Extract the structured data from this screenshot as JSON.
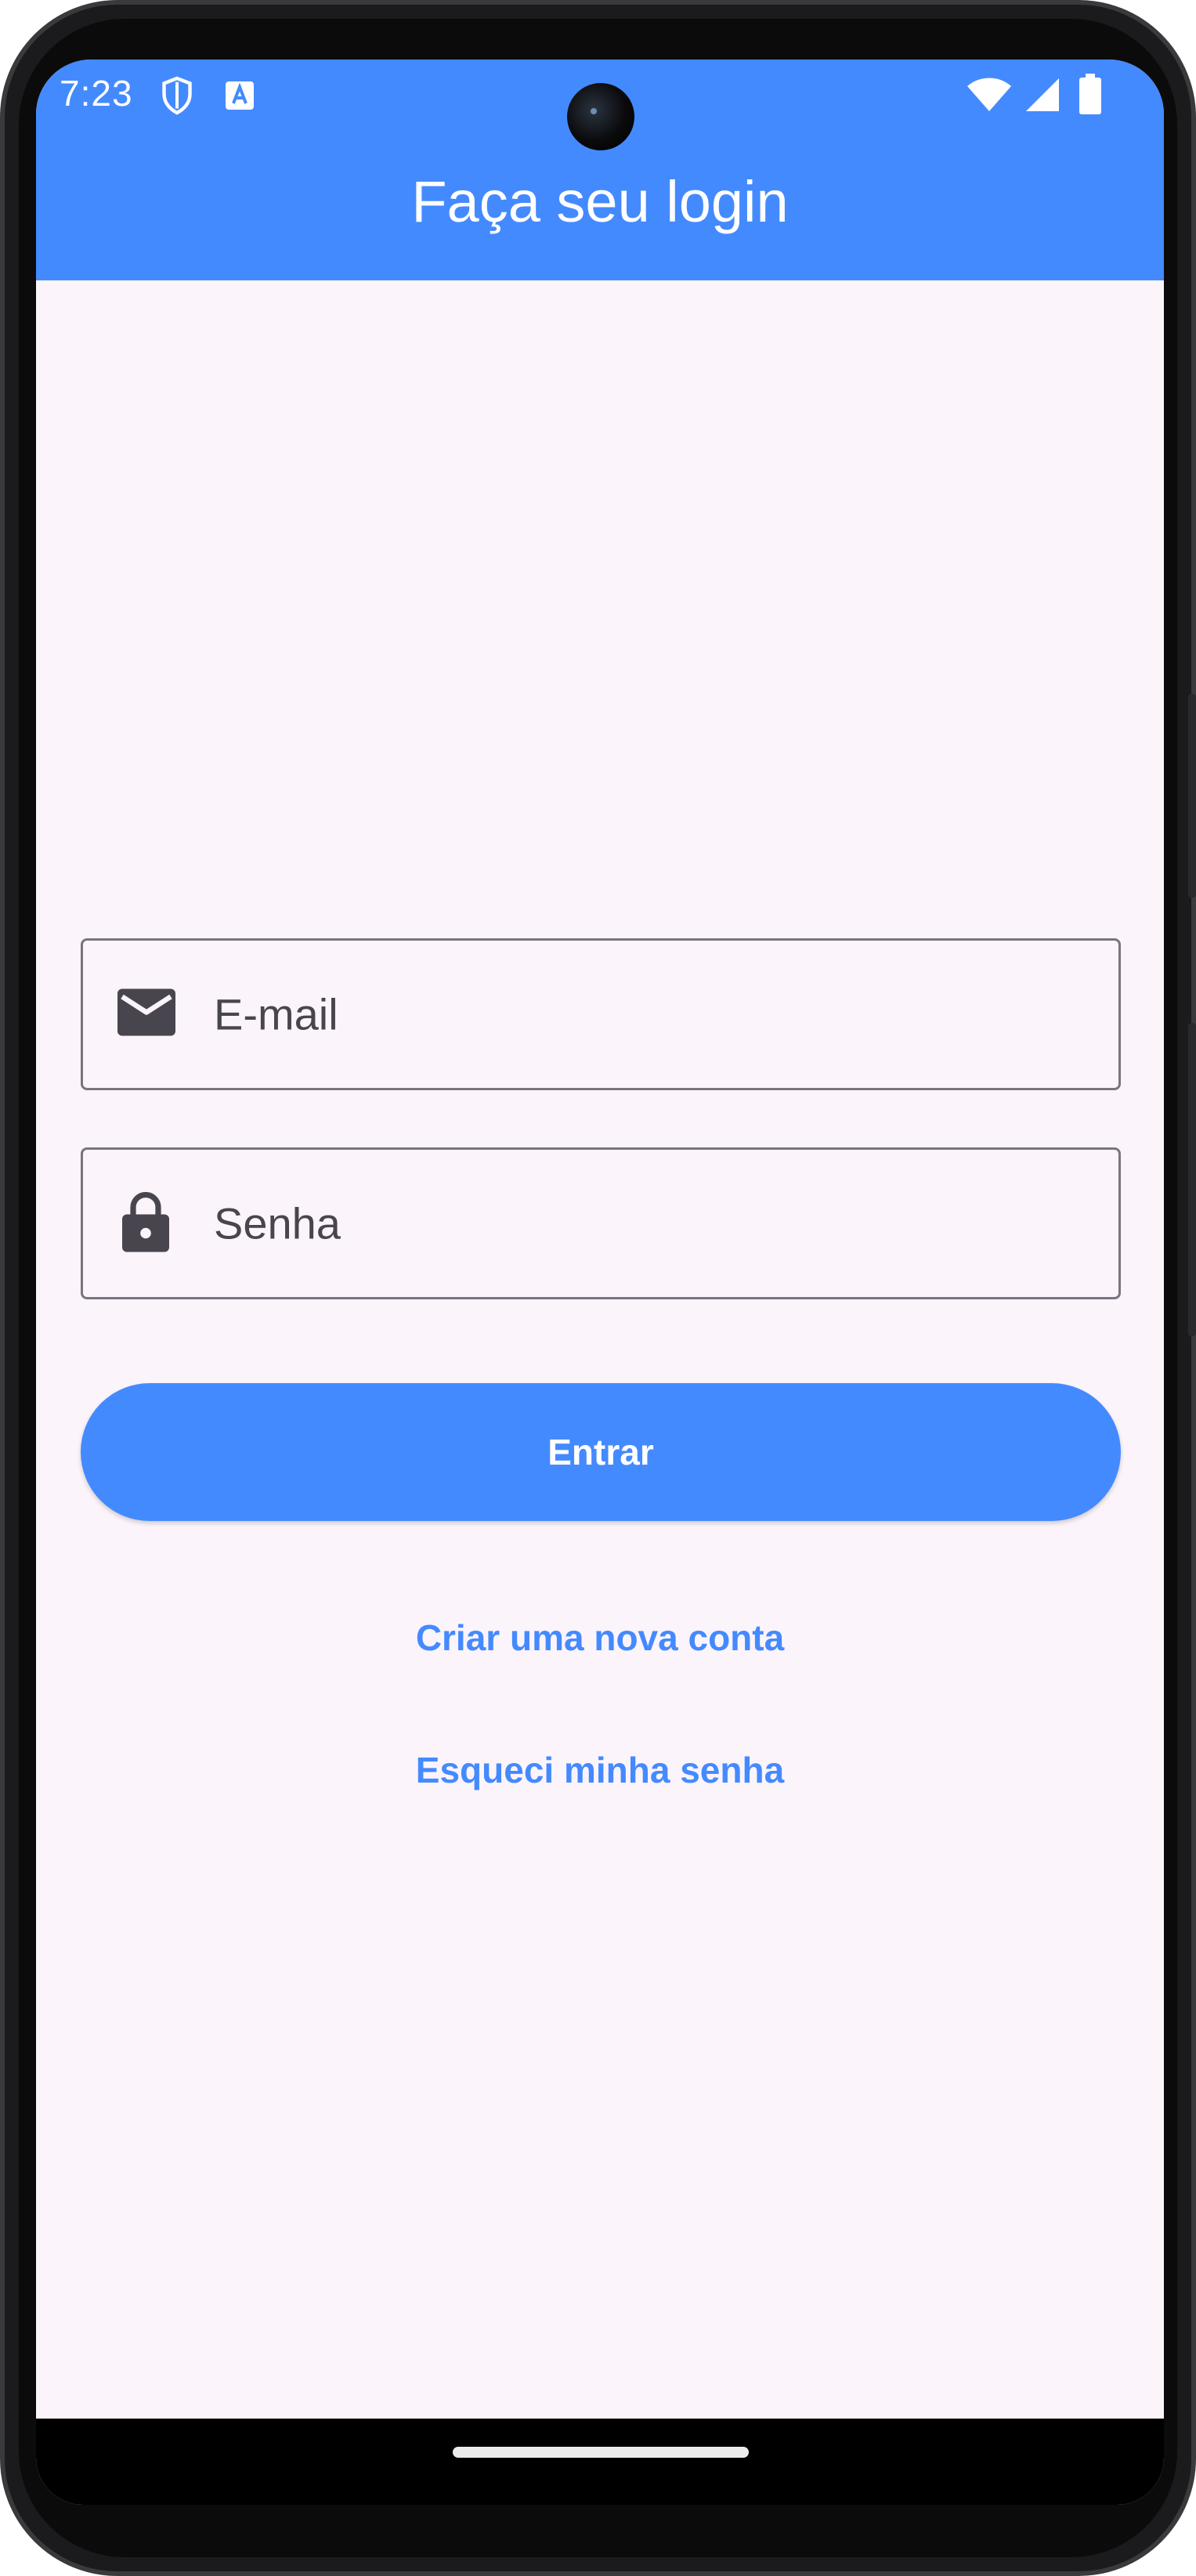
{
  "status_bar": {
    "time": "7:23",
    "icons": [
      "shield-icon",
      "translate-a-icon",
      "wifi-icon",
      "cell-signal-icon",
      "battery-icon"
    ]
  },
  "app_bar": {
    "title": "Faça seu login",
    "color": "#448aff"
  },
  "form": {
    "email_label": "E-mail",
    "email_icon": "envelope-icon",
    "password_label": "Senha",
    "password_icon": "lock-icon"
  },
  "actions": {
    "login_label": "Entrar",
    "create_account_label": "Criar uma nova conta",
    "forgot_password_label": "Esqueci minha senha"
  },
  "colors": {
    "primary": "#448aff",
    "background": "#fcf4fb",
    "field_border": "#79747e",
    "field_text": "#49454f"
  }
}
